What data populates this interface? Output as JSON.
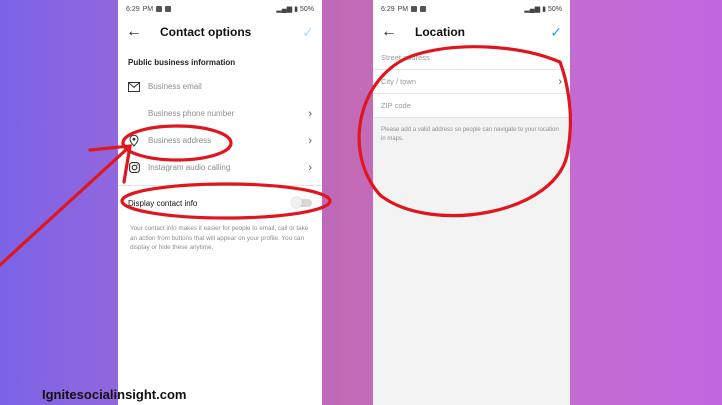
{
  "left_screen": {
    "status": {
      "time": "6:29",
      "ampm": "PM",
      "battery": "50%"
    },
    "title": "Contact options",
    "section_label": "Public business information",
    "rows": [
      {
        "label": "Business email",
        "icon": "email-icon",
        "chevron": false
      },
      {
        "label": "Business phone number",
        "icon": "phone-icon",
        "chevron": true
      },
      {
        "label": "Business address",
        "icon": "location-pin-icon",
        "chevron": true
      },
      {
        "label": "Instagram audio calling",
        "icon": "instagram-icon",
        "chevron": true
      }
    ],
    "toggle_label": "Display contact info",
    "toggle_on": false,
    "help_text": "Your contact info makes it easier for people to email, call or take an action from buttons that will appear on your profile. You can display or hide these anytime."
  },
  "right_screen": {
    "status": {
      "time": "6:29",
      "ampm": "PM",
      "battery": "50%"
    },
    "title": "Location",
    "fields": [
      {
        "placeholder": "Street address",
        "chevron": false
      },
      {
        "placeholder": "City / town",
        "chevron": true
      },
      {
        "placeholder": "ZIP code",
        "chevron": false
      }
    ],
    "help_text": "Please add a valid address so people can navigate to your location in maps."
  },
  "watermark": "Ignitesocialinsight.com",
  "colors": {
    "annotation": "#e0161e",
    "accent": "#3897f0",
    "check_disabled": "#a9dcf2"
  }
}
